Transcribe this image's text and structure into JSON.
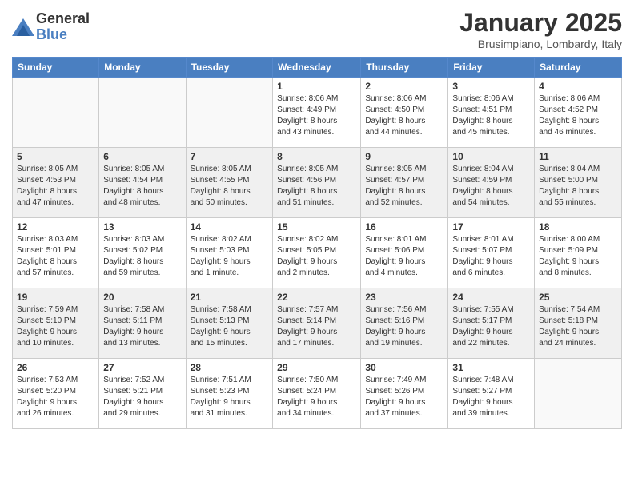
{
  "logo": {
    "general": "General",
    "blue": "Blue"
  },
  "header": {
    "month": "January 2025",
    "location": "Brusimpiano, Lombardy, Italy"
  },
  "weekdays": [
    "Sunday",
    "Monday",
    "Tuesday",
    "Wednesday",
    "Thursday",
    "Friday",
    "Saturday"
  ],
  "weeks": [
    [
      {
        "day": "",
        "info": ""
      },
      {
        "day": "",
        "info": ""
      },
      {
        "day": "",
        "info": ""
      },
      {
        "day": "1",
        "info": "Sunrise: 8:06 AM\nSunset: 4:49 PM\nDaylight: 8 hours\nand 43 minutes."
      },
      {
        "day": "2",
        "info": "Sunrise: 8:06 AM\nSunset: 4:50 PM\nDaylight: 8 hours\nand 44 minutes."
      },
      {
        "day": "3",
        "info": "Sunrise: 8:06 AM\nSunset: 4:51 PM\nDaylight: 8 hours\nand 45 minutes."
      },
      {
        "day": "4",
        "info": "Sunrise: 8:06 AM\nSunset: 4:52 PM\nDaylight: 8 hours\nand 46 minutes."
      }
    ],
    [
      {
        "day": "5",
        "info": "Sunrise: 8:05 AM\nSunset: 4:53 PM\nDaylight: 8 hours\nand 47 minutes."
      },
      {
        "day": "6",
        "info": "Sunrise: 8:05 AM\nSunset: 4:54 PM\nDaylight: 8 hours\nand 48 minutes."
      },
      {
        "day": "7",
        "info": "Sunrise: 8:05 AM\nSunset: 4:55 PM\nDaylight: 8 hours\nand 50 minutes."
      },
      {
        "day": "8",
        "info": "Sunrise: 8:05 AM\nSunset: 4:56 PM\nDaylight: 8 hours\nand 51 minutes."
      },
      {
        "day": "9",
        "info": "Sunrise: 8:05 AM\nSunset: 4:57 PM\nDaylight: 8 hours\nand 52 minutes."
      },
      {
        "day": "10",
        "info": "Sunrise: 8:04 AM\nSunset: 4:59 PM\nDaylight: 8 hours\nand 54 minutes."
      },
      {
        "day": "11",
        "info": "Sunrise: 8:04 AM\nSunset: 5:00 PM\nDaylight: 8 hours\nand 55 minutes."
      }
    ],
    [
      {
        "day": "12",
        "info": "Sunrise: 8:03 AM\nSunset: 5:01 PM\nDaylight: 8 hours\nand 57 minutes."
      },
      {
        "day": "13",
        "info": "Sunrise: 8:03 AM\nSunset: 5:02 PM\nDaylight: 8 hours\nand 59 minutes."
      },
      {
        "day": "14",
        "info": "Sunrise: 8:02 AM\nSunset: 5:03 PM\nDaylight: 9 hours\nand 1 minute."
      },
      {
        "day": "15",
        "info": "Sunrise: 8:02 AM\nSunset: 5:05 PM\nDaylight: 9 hours\nand 2 minutes."
      },
      {
        "day": "16",
        "info": "Sunrise: 8:01 AM\nSunset: 5:06 PM\nDaylight: 9 hours\nand 4 minutes."
      },
      {
        "day": "17",
        "info": "Sunrise: 8:01 AM\nSunset: 5:07 PM\nDaylight: 9 hours\nand 6 minutes."
      },
      {
        "day": "18",
        "info": "Sunrise: 8:00 AM\nSunset: 5:09 PM\nDaylight: 9 hours\nand 8 minutes."
      }
    ],
    [
      {
        "day": "19",
        "info": "Sunrise: 7:59 AM\nSunset: 5:10 PM\nDaylight: 9 hours\nand 10 minutes."
      },
      {
        "day": "20",
        "info": "Sunrise: 7:58 AM\nSunset: 5:11 PM\nDaylight: 9 hours\nand 13 minutes."
      },
      {
        "day": "21",
        "info": "Sunrise: 7:58 AM\nSunset: 5:13 PM\nDaylight: 9 hours\nand 15 minutes."
      },
      {
        "day": "22",
        "info": "Sunrise: 7:57 AM\nSunset: 5:14 PM\nDaylight: 9 hours\nand 17 minutes."
      },
      {
        "day": "23",
        "info": "Sunrise: 7:56 AM\nSunset: 5:16 PM\nDaylight: 9 hours\nand 19 minutes."
      },
      {
        "day": "24",
        "info": "Sunrise: 7:55 AM\nSunset: 5:17 PM\nDaylight: 9 hours\nand 22 minutes."
      },
      {
        "day": "25",
        "info": "Sunrise: 7:54 AM\nSunset: 5:18 PM\nDaylight: 9 hours\nand 24 minutes."
      }
    ],
    [
      {
        "day": "26",
        "info": "Sunrise: 7:53 AM\nSunset: 5:20 PM\nDaylight: 9 hours\nand 26 minutes."
      },
      {
        "day": "27",
        "info": "Sunrise: 7:52 AM\nSunset: 5:21 PM\nDaylight: 9 hours\nand 29 minutes."
      },
      {
        "day": "28",
        "info": "Sunrise: 7:51 AM\nSunset: 5:23 PM\nDaylight: 9 hours\nand 31 minutes."
      },
      {
        "day": "29",
        "info": "Sunrise: 7:50 AM\nSunset: 5:24 PM\nDaylight: 9 hours\nand 34 minutes."
      },
      {
        "day": "30",
        "info": "Sunrise: 7:49 AM\nSunset: 5:26 PM\nDaylight: 9 hours\nand 37 minutes."
      },
      {
        "day": "31",
        "info": "Sunrise: 7:48 AM\nSunset: 5:27 PM\nDaylight: 9 hours\nand 39 minutes."
      },
      {
        "day": "",
        "info": ""
      }
    ]
  ]
}
